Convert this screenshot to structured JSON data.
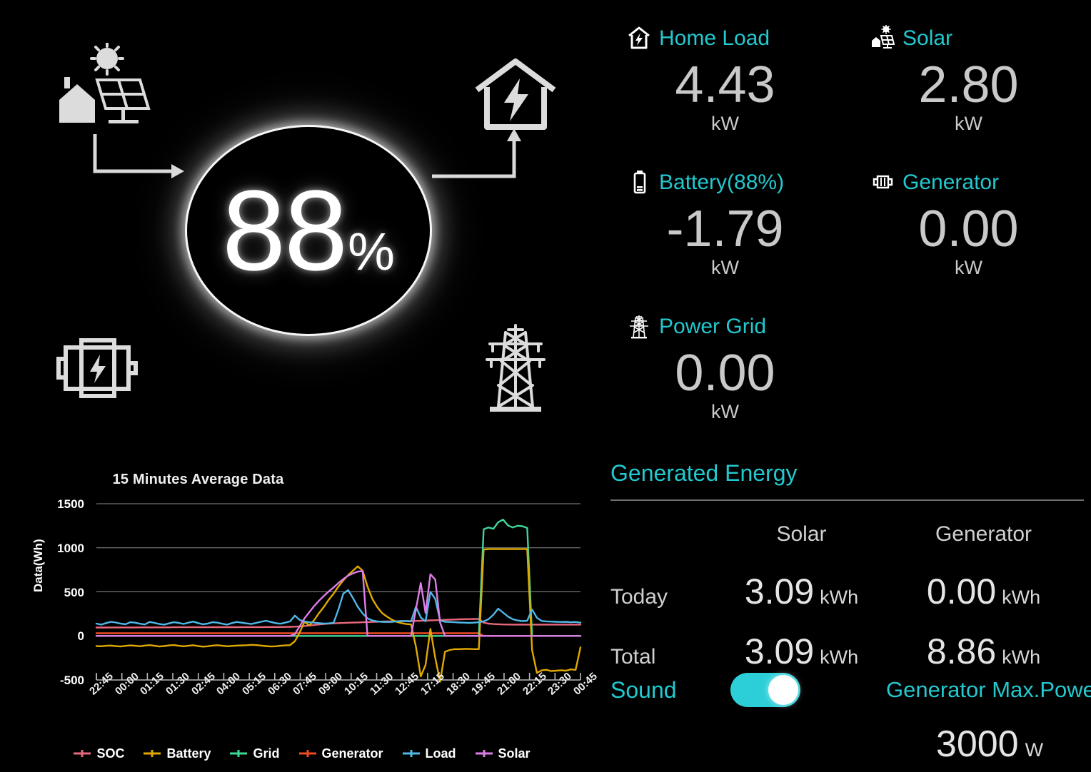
{
  "flow": {
    "soc_value": "88",
    "soc_unit": "%",
    "icons": {
      "solar": "solar-panel-house-sun-icon",
      "house": "house-lightning-icon",
      "battery": "battery-lightning-icon",
      "grid": "power-grid-tower-icon"
    }
  },
  "stats": {
    "accent_color": "#22c9cf",
    "value_color": "#c9c9c9",
    "items": [
      {
        "name": "home-load",
        "icon": "house-lightning-icon",
        "label": "Home Load",
        "value": "4.43",
        "unit": "kW"
      },
      {
        "name": "solar",
        "icon": "solar-panel-icon",
        "label": "Solar",
        "value": "2.80",
        "unit": "kW"
      },
      {
        "name": "battery",
        "icon": "battery-icon",
        "label": "Battery(88%)",
        "value": "-1.79",
        "unit": "kW"
      },
      {
        "name": "generator",
        "icon": "generator-icon",
        "label": "Generator",
        "value": "0.00",
        "unit": "kW"
      },
      {
        "name": "power-grid",
        "icon": "power-grid-tower-icon",
        "label": "Power Grid",
        "value": "0.00",
        "unit": "kW"
      }
    ]
  },
  "energy": {
    "title": "Generated Energy",
    "columns": [
      "Solar",
      "Generator"
    ],
    "rows": [
      {
        "label": "Today",
        "cells": [
          {
            "value": "3.09",
            "unit": "kWh"
          },
          {
            "value": "0.00",
            "unit": "kWh"
          }
        ]
      },
      {
        "label": "Total",
        "cells": [
          {
            "value": "3.09",
            "unit": "kWh"
          },
          {
            "value": "8.86",
            "unit": "kWh"
          }
        ]
      }
    ]
  },
  "controls": {
    "sound_label": "Sound",
    "sound_on": true,
    "toggle_color": "#2ccfd8",
    "gen_max_label": "Generator Max.Power",
    "gen_max_value": "3000",
    "gen_max_unit": "W"
  },
  "chart_data": {
    "type": "line",
    "title": "15 Minutes Average Data",
    "xlabel": "",
    "ylabel": "Data(Wh)",
    "ylim": [
      -500,
      1500
    ],
    "yticks": [
      1500,
      1000,
      500,
      0,
      -500
    ],
    "grid": true,
    "legend_position": "bottom",
    "categories": [
      "22:45",
      "00:00",
      "01:15",
      "01:30",
      "02:45",
      "04:00",
      "05:15",
      "06:30",
      "07:45",
      "09:00",
      "10:15",
      "11:30",
      "12:45",
      "17:15",
      "18:30",
      "19:45",
      "21:00",
      "22:15",
      "23:30",
      "00:45"
    ],
    "x": [
      0,
      1,
      2,
      3,
      4,
      5,
      6,
      7,
      8,
      9,
      10,
      11,
      12,
      13,
      14,
      15,
      16,
      17,
      18,
      19,
      20,
      21,
      22,
      23,
      24,
      25,
      26,
      27,
      28,
      29,
      30,
      31,
      32,
      33,
      34,
      35,
      36,
      37,
      38,
      39,
      40,
      41,
      42,
      43,
      44,
      45,
      46,
      47,
      48,
      49,
      50,
      51,
      52,
      53,
      54,
      55,
      56,
      57,
      58,
      59,
      60,
      61,
      62,
      63,
      64,
      65,
      66,
      67,
      68,
      69,
      70,
      71,
      72,
      73,
      74,
      75,
      76,
      77,
      78,
      79,
      80,
      81,
      82,
      83,
      84,
      85,
      86,
      87,
      88,
      89,
      90,
      91,
      92,
      93,
      94,
      95,
      96,
      97,
      98,
      99,
      100
    ],
    "series": [
      {
        "name": "SOC",
        "color": "#e8697c",
        "values": [
          95,
          95,
          95,
          96,
          96,
          96,
          96,
          96,
          96,
          97,
          97,
          97,
          97,
          97,
          97,
          97,
          98,
          98,
          98,
          98,
          98,
          98,
          98,
          98,
          99,
          99,
          99,
          99,
          99,
          99,
          100,
          100,
          100,
          100,
          100,
          101,
          101,
          101,
          101,
          102,
          103,
          105,
          108,
          112,
          118,
          124,
          130,
          135,
          139,
          142,
          145,
          147,
          149,
          151,
          153,
          155,
          157,
          159,
          161,
          163,
          164,
          165,
          166,
          167,
          168,
          169,
          170,
          172,
          174,
          176,
          178,
          180,
          182,
          184,
          186,
          188,
          190,
          191,
          192,
          193,
          150,
          140,
          135,
          132,
          130,
          129,
          128,
          128,
          128,
          128,
          128,
          128,
          128,
          128,
          128,
          128,
          128,
          128,
          128,
          128,
          128
        ]
      },
      {
        "name": "Battery",
        "color": "#e0a900",
        "values": [
          -115,
          -118,
          -112,
          -110,
          -116,
          -120,
          -113,
          -108,
          -112,
          -118,
          -110,
          -105,
          -112,
          -120,
          -115,
          -108,
          -104,
          -112,
          -118,
          -112,
          -106,
          -115,
          -122,
          -118,
          -110,
          -106,
          -112,
          -118,
          -114,
          -110,
          -108,
          -106,
          -102,
          -104,
          -110,
          -115,
          -120,
          -118,
          -112,
          -108,
          -105,
          -60,
          40,
          160,
          120,
          180,
          260,
          330,
          410,
          480,
          560,
          630,
          690,
          740,
          790,
          740,
          560,
          420,
          330,
          260,
          220,
          185,
          160,
          145,
          135,
          130,
          -120,
          -460,
          -330,
          80,
          -250,
          -520,
          -180,
          -160,
          -150,
          -150,
          -148,
          -148,
          -150,
          -150,
          980,
          985,
          985,
          985,
          985,
          985,
          985,
          985,
          985,
          985,
          -160,
          -420,
          -390,
          -385,
          -400,
          -395,
          -390,
          -395,
          -380,
          -385,
          -130
        ]
      },
      {
        "name": "Grid",
        "color": "#3fd69a",
        "values": [
          0,
          0,
          0,
          0,
          0,
          0,
          0,
          0,
          0,
          0,
          0,
          0,
          0,
          0,
          0,
          0,
          0,
          0,
          0,
          0,
          0,
          0,
          0,
          0,
          0,
          0,
          0,
          0,
          0,
          0,
          0,
          0,
          0,
          0,
          0,
          0,
          0,
          0,
          0,
          0,
          0,
          0,
          0,
          0,
          0,
          0,
          0,
          0,
          0,
          0,
          0,
          0,
          0,
          0,
          0,
          0,
          0,
          0,
          0,
          0,
          0,
          0,
          0,
          0,
          0,
          0,
          0,
          0,
          0,
          0,
          0,
          0,
          0,
          0,
          0,
          0,
          0,
          0,
          0,
          0,
          1210,
          1230,
          1215,
          1290,
          1320,
          1255,
          1230,
          1250,
          1245,
          1225,
          0,
          0,
          0,
          0,
          0,
          0,
          0,
          0,
          0,
          0,
          0
        ]
      },
      {
        "name": "Generator",
        "color": "#f04a22",
        "values": [
          30,
          30,
          30,
          30,
          30,
          30,
          30,
          30,
          30,
          30,
          30,
          30,
          30,
          30,
          30,
          30,
          30,
          30,
          30,
          30,
          30,
          30,
          30,
          30,
          30,
          30,
          30,
          30,
          30,
          30,
          30,
          30,
          30,
          30,
          30,
          30,
          30,
          30,
          30,
          30,
          30,
          30,
          30,
          30,
          30,
          30,
          30,
          30,
          30,
          30,
          30,
          30,
          30,
          30,
          30,
          30,
          30,
          30,
          30,
          30,
          30,
          30,
          30,
          30,
          30,
          30,
          30,
          30,
          30,
          30,
          30,
          30,
          30,
          30,
          30,
          30,
          30,
          30,
          30,
          30,
          0,
          0,
          0,
          0,
          0,
          0,
          0,
          0,
          0,
          0,
          0,
          0,
          0,
          0,
          0,
          0,
          0,
          0,
          0,
          0,
          0
        ]
      },
      {
        "name": "Load",
        "color": "#4fb8e8",
        "values": [
          140,
          128,
          145,
          160,
          152,
          140,
          132,
          155,
          150,
          138,
          130,
          158,
          148,
          135,
          128,
          142,
          155,
          148,
          136,
          150,
          162,
          145,
          132,
          140,
          156,
          150,
          138,
          128,
          145,
          158,
          150,
          142,
          135,
          148,
          160,
          172,
          158,
          145,
          138,
          150,
          165,
          230,
          180,
          165,
          155,
          150,
          145,
          140,
          142,
          148,
          300,
          480,
          520,
          430,
          330,
          255,
          200,
          175,
          165,
          160,
          158,
          160,
          165,
          170,
          168,
          165,
          330,
          210,
          165,
          500,
          420,
          175,
          160,
          158,
          155,
          152,
          150,
          148,
          150,
          155,
          165,
          190,
          240,
          310,
          265,
          220,
          190,
          175,
          168,
          172,
          300,
          205,
          170,
          165,
          162,
          160,
          158,
          160,
          155,
          158,
          150
        ]
      },
      {
        "name": "Solar",
        "color": "#dd7ee8",
        "values": [
          0,
          0,
          0,
          0,
          0,
          0,
          0,
          0,
          0,
          0,
          0,
          0,
          0,
          0,
          0,
          0,
          0,
          0,
          0,
          0,
          0,
          0,
          0,
          0,
          0,
          0,
          0,
          0,
          0,
          0,
          0,
          0,
          0,
          0,
          0,
          0,
          0,
          0,
          0,
          0,
          0,
          20,
          110,
          200,
          270,
          340,
          400,
          455,
          505,
          550,
          600,
          645,
          685,
          710,
          730,
          735,
          0,
          0,
          0,
          0,
          0,
          0,
          0,
          0,
          0,
          0,
          300,
          600,
          260,
          700,
          640,
          150,
          0,
          0,
          0,
          0,
          0,
          0,
          0,
          0,
          0,
          0,
          0,
          0,
          0,
          0,
          0,
          0,
          0,
          0,
          0,
          0,
          0,
          0,
          0,
          0,
          0,
          0,
          0,
          0,
          0
        ]
      }
    ]
  }
}
